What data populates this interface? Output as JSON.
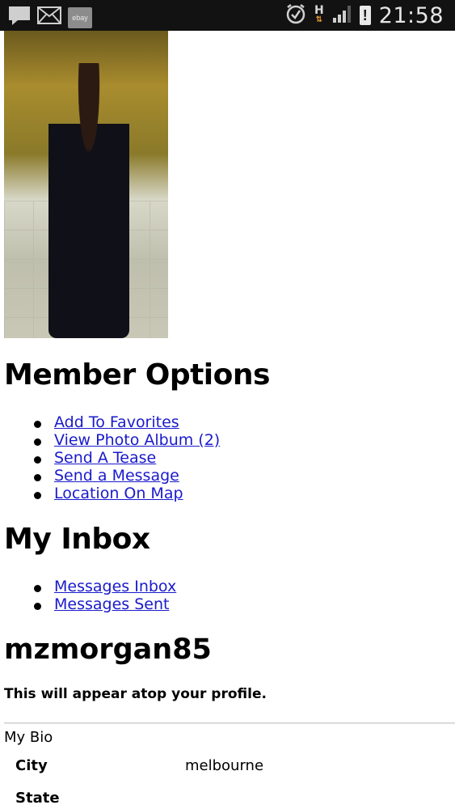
{
  "status_bar": {
    "time": "21:58",
    "ebay_label": "ebay",
    "network_label": "H",
    "icons": [
      "chat-icon",
      "mail-icon",
      "ebay-app-icon",
      "alarm-icon",
      "data-arrows-icon",
      "signal-icon",
      "warning-icon"
    ]
  },
  "member_options": {
    "heading": "Member Options",
    "items": [
      "Add To Favorites",
      "View Photo Album (2)",
      "Send A Tease",
      "Send a Message",
      "Location On Map"
    ]
  },
  "inbox": {
    "heading": "My Inbox",
    "items": [
      "Messages Inbox",
      "Messages Sent"
    ]
  },
  "profile": {
    "username": "mzmorgan85",
    "note": "This will appear atop your profile.",
    "bio_title": "My Bio",
    "fields": [
      {
        "label": "City",
        "value": "melbourne"
      },
      {
        "label": "State",
        "value": ""
      }
    ]
  },
  "colors": {
    "link": "#1a1acc",
    "status_bar": "#121212"
  }
}
